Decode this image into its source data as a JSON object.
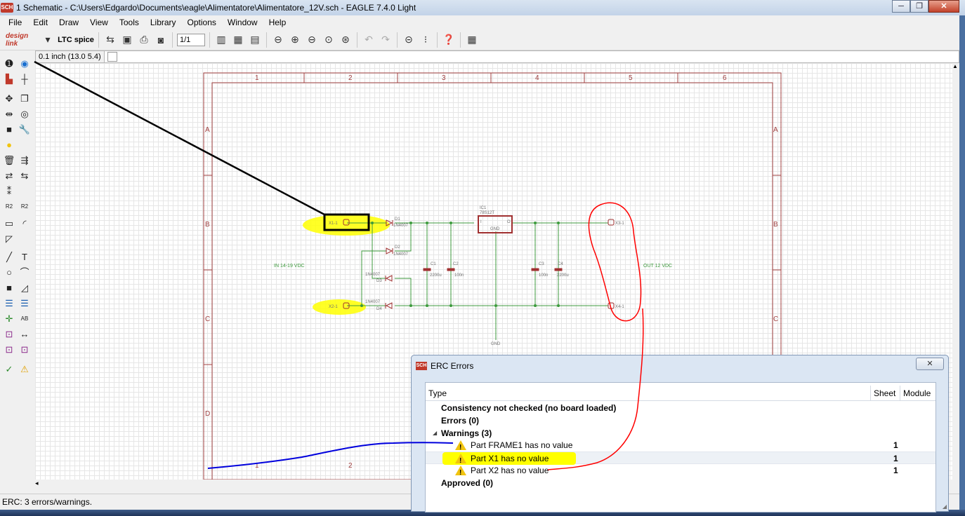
{
  "window": {
    "app_icon_text": "SCH",
    "title": "1 Schematic - C:\\Users\\Edgardo\\Documents\\eagle\\Alimentatore\\Alimentatore_12V.sch - EAGLE 7.4.0 Light",
    "minimize": "─",
    "maximize": "❐",
    "close": "✕"
  },
  "menu": [
    "File",
    "Edit",
    "Draw",
    "View",
    "Tools",
    "Library",
    "Options",
    "Window",
    "Help"
  ],
  "toolbar": {
    "design_link": "design link",
    "ltspice": "LTC spice",
    "zoom_select": "1/1",
    "icons": [
      "open-icon",
      "save-icon",
      "print-icon",
      "cam-icon",
      "zoom-fit-icon",
      "zoom-in-icon",
      "zoom-out-icon",
      "zoom-redraw-icon",
      "zoom-select-icon",
      "undo-icon",
      "redo-icon",
      "stop-icon",
      "go-icon",
      "help-icon",
      "grid-icon"
    ]
  },
  "command": {
    "coordinate": "0.1 inch (13.0 5.4)",
    "value": ""
  },
  "schematic": {
    "columns": [
      "1",
      "2",
      "3",
      "4",
      "5",
      "6"
    ],
    "rows": [
      "A",
      "B",
      "C",
      "D"
    ],
    "parts": {
      "x1": "X1-1",
      "x2": "X2-1",
      "x3": "X3-1",
      "x4": "X4-1",
      "ic1": "IC1",
      "ic1_value": "78S12T",
      "d1": "D1",
      "d2": "D2",
      "d3": "D3",
      "d4": "D4",
      "diode_value": "1N4007",
      "c1": "C1",
      "c2": "C2",
      "c3": "C3",
      "c4": "C4",
      "cap_value_1": "2200u",
      "cap_value_2": "100n",
      "gnd": "GND",
      "in_label": "IN 14-19 VDC",
      "out_label": "OUT 12 VDC",
      "ic_pins": [
        "I",
        "GND",
        "O"
      ]
    }
  },
  "erc_dialog": {
    "icon_text": "SCH",
    "title": "ERC Errors",
    "close": "✕",
    "columns": [
      "Type",
      "Sheet",
      "Module"
    ],
    "items": [
      {
        "label": "Consistency not checked (no board loaded)",
        "sheet": "",
        "bold": true
      },
      {
        "label": "Errors (0)",
        "sheet": "",
        "bold": true
      },
      {
        "label": "Warnings (3)",
        "sheet": "",
        "bold": true
      },
      {
        "label": "Part FRAME1 has no value",
        "sheet": "1",
        "bold": false
      },
      {
        "label": "Part X1 has no value",
        "sheet": "1",
        "bold": false
      },
      {
        "label": "Part X2 has no value",
        "sheet": "1",
        "bold": false
      },
      {
        "label": "Approved (0)",
        "sheet": "",
        "bold": true
      }
    ]
  },
  "status": {
    "text": "ERC: 3 errors/warnings."
  },
  "colors": {
    "frame": "#a04040",
    "wire": "#3c9a3c",
    "part": "#a03030",
    "highlight": "#ffff00",
    "annotation_red": "#ff0000",
    "annotation_blue": "#0000dd",
    "annotation_black": "#000000"
  }
}
